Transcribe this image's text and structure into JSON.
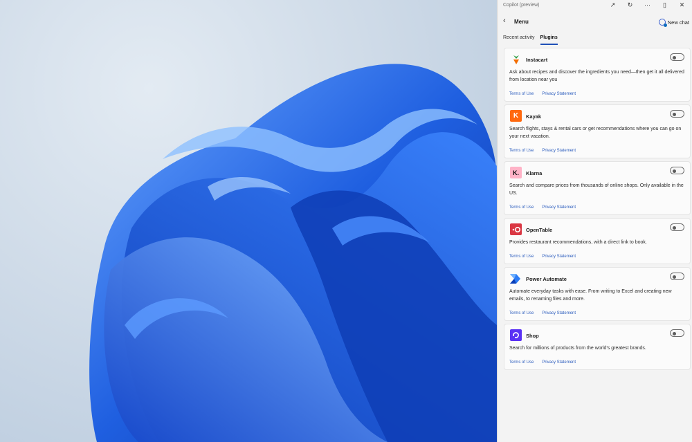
{
  "titlebar": {
    "title": "Copilot (preview)",
    "icons": [
      "open-external-icon",
      "refresh-icon",
      "more-icon",
      "dock-icon",
      "close-icon"
    ]
  },
  "menu": {
    "title": "Menu",
    "new_chat": "New chat"
  },
  "tabs": [
    {
      "label": "Recent activity",
      "active": false
    },
    {
      "label": "Plugins",
      "active": true
    }
  ],
  "plugins": [
    {
      "name": "Instacart",
      "description": "Ask about recipes and discover the ingredients you need—then get it all delivered from location near you",
      "terms": "Terms of Use",
      "privacy": "Privacy Statement",
      "logo_color": "#ffffff",
      "enabled": false
    },
    {
      "name": "Kayak",
      "description": "Search flights, stays & rental cars or get recommendations where you can go on your next vacation.",
      "terms": "Terms of Use",
      "privacy": "Privacy Statement",
      "logo_color": "#ff690f",
      "logo_letter": "K",
      "enabled": false
    },
    {
      "name": "Klarna",
      "description": "Search and compare prices from thousands of online shops. Only available in the US.",
      "terms": "Terms of Use",
      "privacy": "Privacy Statement",
      "logo_color": "#ffb3c7",
      "logo_letter": "K.",
      "enabled": false
    },
    {
      "name": "OpenTable",
      "description": "Provides restaurant recommendations, with a direct link to book.",
      "terms": "Terms of Use",
      "privacy": "Privacy Statement",
      "logo_color": "#da3743",
      "enabled": false
    },
    {
      "name": "Power Automate",
      "description": "Automate everyday tasks with ease. From writing to Excel and creating new emails, to renaming files and more.",
      "terms": "Terms of Use",
      "privacy": "Privacy Statement",
      "logo_color": "#0066ff",
      "enabled": false
    },
    {
      "name": "Shop",
      "description": "Search for millions of products from the world's greatest brands.",
      "terms": "Terms of Use",
      "privacy": "Privacy Statement",
      "logo_color": "#5a31f4",
      "enabled": false
    }
  ]
}
